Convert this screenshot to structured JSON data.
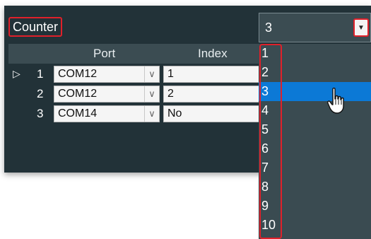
{
  "counter": {
    "label": "Counter"
  },
  "select": {
    "value": "3",
    "button_glyph": "▼"
  },
  "grid": {
    "columns": [
      "Port",
      "Index"
    ],
    "rows": [
      {
        "num": "1",
        "port": "COM12",
        "index": "1",
        "current": true
      },
      {
        "num": "2",
        "port": "COM12",
        "index": "2",
        "current": false
      },
      {
        "num": "3",
        "port": "COM14",
        "index": "No",
        "current": false
      }
    ]
  },
  "dropdown": {
    "options": [
      "1",
      "2",
      "3",
      "4",
      "5",
      "6",
      "7",
      "8",
      "9",
      "10"
    ],
    "selected": "3"
  },
  "icons": {
    "row_marker": "row-indicator-icon",
    "cell_caret": "chevron-down-icon",
    "cursor": "hand-pointer-icon"
  },
  "colors": {
    "panel": "#223238",
    "header": "#3b4c52",
    "highlight": "#0c79d6",
    "annotation": "#e0202a"
  }
}
